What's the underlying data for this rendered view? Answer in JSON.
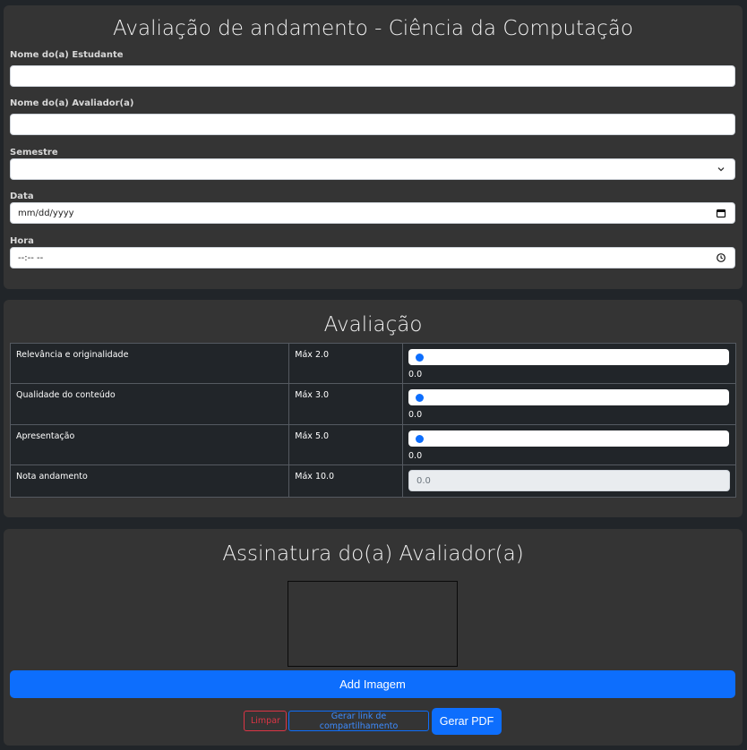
{
  "form": {
    "title": "Avaliação de andamento - Ciência da Computação",
    "student_label": "Nome do(a) Estudante",
    "student_value": "",
    "evaluator_label": "Nome do(a) Avaliador(a)",
    "evaluator_value": "",
    "semester_label": "Semestre",
    "semester_value": "",
    "date_label": "Data",
    "date_placeholder": "mm/dd/yyyy",
    "time_label": "Hora",
    "time_placeholder": "--:-- --"
  },
  "evaluation": {
    "title": "Avaliação",
    "rows": [
      {
        "criterion": "Relevância e originalidade",
        "max": "Máx 2.0",
        "value": "0.0",
        "level": 0
      },
      {
        "criterion": "Qualidade do conteúdo",
        "max": "Máx 3.0",
        "value": "0.0",
        "level": 0
      },
      {
        "criterion": "Apresentação",
        "max": "Máx 5.0",
        "value": "0.0",
        "level": 0
      }
    ],
    "total": {
      "criterion": "Nota andamento",
      "max": "Máx 10.0",
      "value": "0.0"
    }
  },
  "signature": {
    "title": "Assinatura do(a) Avaliador(a)",
    "add_image_label": "Add Imagem",
    "clear_label": "Limpar",
    "share_label": "Gerar link de compartilhamento",
    "pdf_label": "Gerar PDF"
  },
  "colors": {
    "primary": "#0d6efd",
    "danger": "#dc3545",
    "card": "#343434",
    "background": "#212529"
  },
  "icons": {
    "select": "chevron-down-icon",
    "date": "calendar-icon",
    "time": "clock-icon"
  }
}
